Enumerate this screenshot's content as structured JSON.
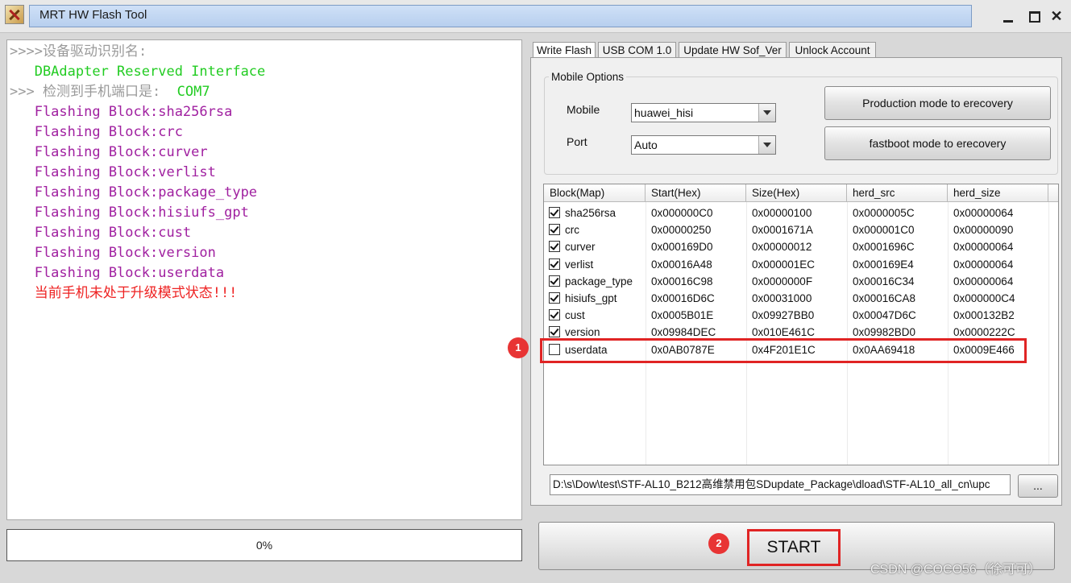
{
  "window": {
    "title": "MRT HW Flash Tool",
    "minimize_glyph": "_",
    "close_glyph": "✕"
  },
  "log": {
    "lines": [
      {
        "text": ">>>>设备驱动识别名:",
        "color": "#9a9a9a"
      },
      {
        "text": "   DBAdapter Reserved Interface",
        "color": "#22cc22"
      },
      {
        "text": ">>> 检测到手机端口是:  COM7",
        "color": "#9a9a9a",
        "accent": "#22cc22"
      },
      {
        "text": "   Flashing Block:sha256rsa",
        "color": "#a020a0"
      },
      {
        "text": "   Flashing Block:crc",
        "color": "#a020a0"
      },
      {
        "text": "   Flashing Block:curver",
        "color": "#a020a0"
      },
      {
        "text": "   Flashing Block:verlist",
        "color": "#a020a0"
      },
      {
        "text": "   Flashing Block:package_type",
        "color": "#a020a0"
      },
      {
        "text": "   Flashing Block:hisiufs_gpt",
        "color": "#a020a0"
      },
      {
        "text": "   Flashing Block:cust",
        "color": "#a020a0"
      },
      {
        "text": "   Flashing Block:version",
        "color": "#a020a0"
      },
      {
        "text": "   Flashing Block:userdata",
        "color": "#a020a0"
      },
      {
        "text": "   当前手机未处于升级模式状态!!!",
        "color": "#ee2222"
      }
    ],
    "line2_prefix": ">>> 检测到手机端口是:  ",
    "line2_port": "COM7"
  },
  "progress": {
    "label": "0%",
    "value": 0
  },
  "tabs": [
    {
      "label": "Write Flash",
      "active": true
    },
    {
      "label": "USB COM 1.0",
      "active": false
    },
    {
      "label": "Update HW Sof_Ver",
      "active": false
    },
    {
      "label": "Unlock Account",
      "active": false
    }
  ],
  "mobile_options": {
    "group_label": "Mobile Options",
    "mobile_label": "Mobile",
    "mobile_value": "huawei_hisi",
    "port_label": "Port",
    "port_value": "Auto",
    "production_button": "Production mode to erecovery",
    "fastboot_button": "fastboot mode to erecovery"
  },
  "table": {
    "headers": [
      "Block(Map)",
      "Start(Hex)",
      "Size(Hex)",
      "herd_src",
      "herd_size"
    ],
    "rows": [
      {
        "checked": true,
        "block": "sha256rsa",
        "start": "0x000000C0",
        "size": "0x00000100",
        "herd_src": "0x0000005C",
        "herd_size": "0x00000064"
      },
      {
        "checked": true,
        "block": "crc",
        "start": "0x00000250",
        "size": "0x0001671A",
        "herd_src": "0x000001C0",
        "herd_size": "0x00000090"
      },
      {
        "checked": true,
        "block": "curver",
        "start": "0x000169D0",
        "size": "0x00000012",
        "herd_src": "0x0001696C",
        "herd_size": "0x00000064"
      },
      {
        "checked": true,
        "block": "verlist",
        "start": "0x00016A48",
        "size": "0x000001EC",
        "herd_src": "0x000169E4",
        "herd_size": "0x00000064"
      },
      {
        "checked": true,
        "block": "package_type",
        "start": "0x00016C98",
        "size": "0x0000000F",
        "herd_src": "0x00016C34",
        "herd_size": "0x00000064"
      },
      {
        "checked": true,
        "block": "hisiufs_gpt",
        "start": "0x00016D6C",
        "size": "0x00031000",
        "herd_src": "0x00016CA8",
        "herd_size": "0x000000C4"
      },
      {
        "checked": true,
        "block": "cust",
        "start": "0x0005B01E",
        "size": "0x09927BB0",
        "herd_src": "0x00047D6C",
        "herd_size": "0x000132B2"
      },
      {
        "checked": true,
        "block": "version",
        "start": "0x09984DEC",
        "size": "0x010E461C",
        "herd_src": "0x09982BD0",
        "herd_size": "0x0000222C"
      },
      {
        "checked": false,
        "block": "userdata",
        "start": "0x0AB0787E",
        "size": "0x4F201E1C",
        "herd_src": "0x0AA69418",
        "herd_size": "0x0009E466"
      }
    ]
  },
  "firmware_path": {
    "value": "D:\\s\\Dow\\test\\STF-AL10_B212高维禁用包SDupdate_Package\\dload\\STF-AL10_all_cn\\upc",
    "browse_label": "..."
  },
  "start_button": {
    "label": "START"
  },
  "annotations": {
    "badge1": "1",
    "badge2": "2",
    "highlight_color": "#e02424"
  },
  "watermark": "CSDN @COCO56（徐可可）"
}
